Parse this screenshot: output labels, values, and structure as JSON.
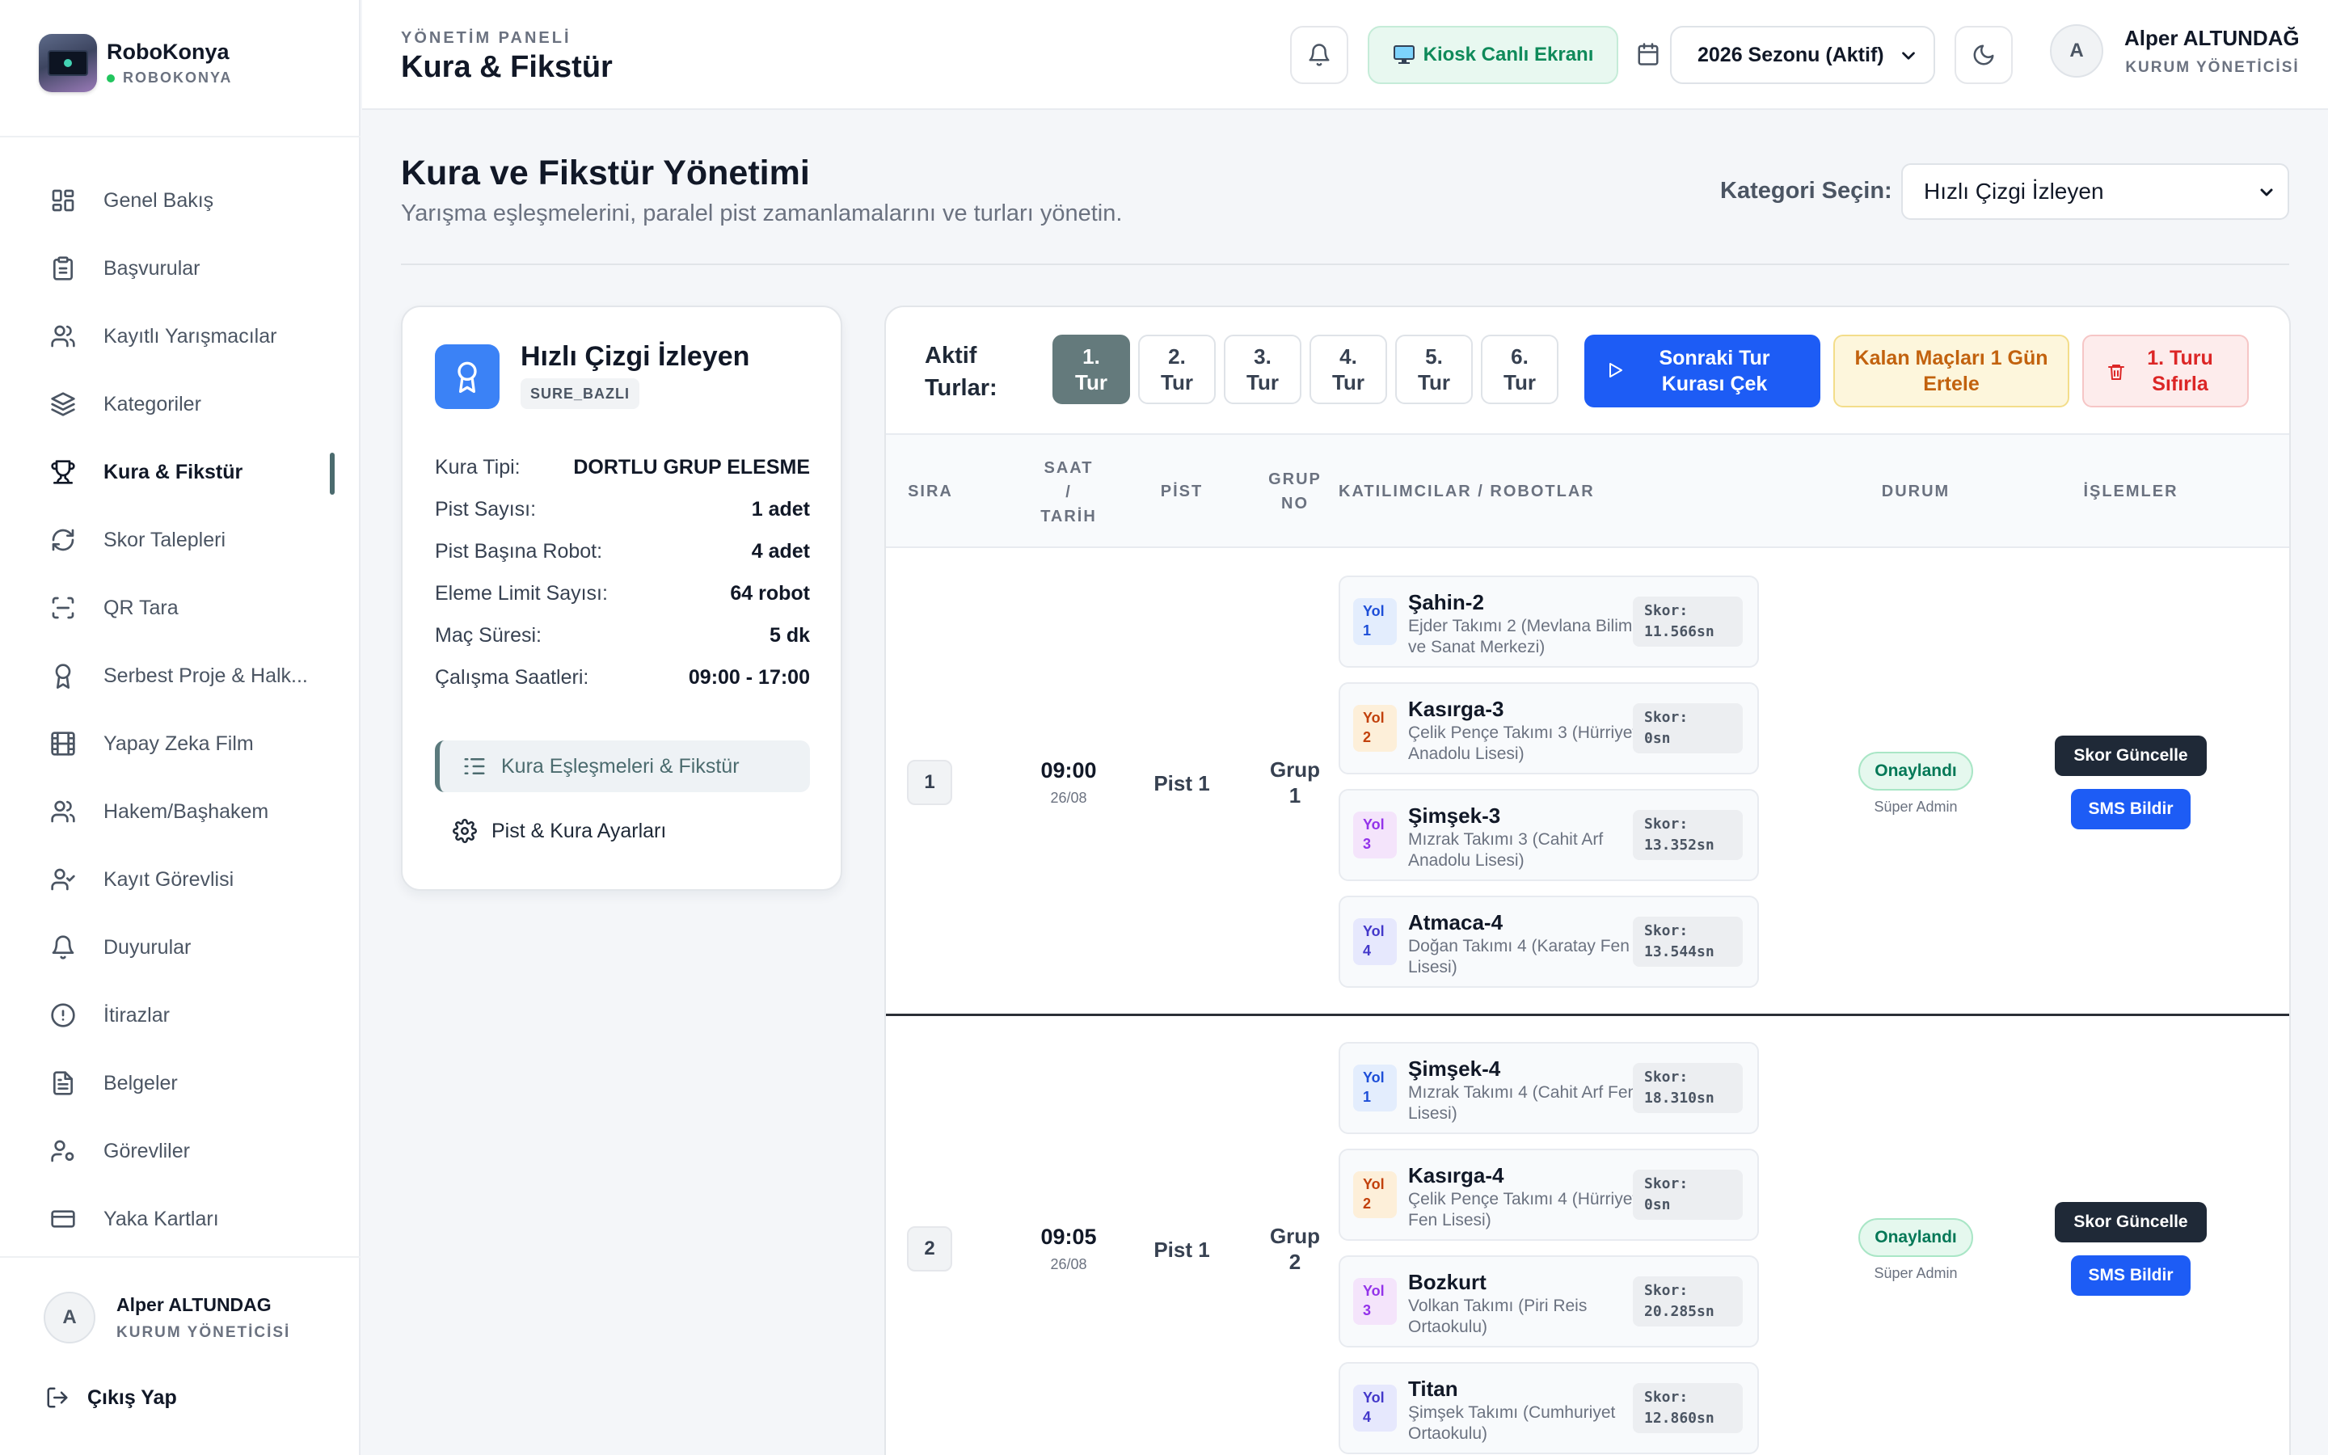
{
  "brand": {
    "name": "RoboKonya",
    "sub": "ROBOKONYA"
  },
  "nav": [
    {
      "label": "Genel Bakış",
      "icon": "grid-icon"
    },
    {
      "label": "Başvurular",
      "icon": "clipboard-icon"
    },
    {
      "label": "Kayıtlı Yarışmacılar",
      "icon": "users-icon"
    },
    {
      "label": "Kategoriler",
      "icon": "layers-icon"
    },
    {
      "label": "Kura & Fikstür",
      "icon": "trophy-icon",
      "active": true
    },
    {
      "label": "Skor Talepleri",
      "icon": "refresh-icon"
    },
    {
      "label": "QR Tara",
      "icon": "scan-icon"
    },
    {
      "label": "Serbest Proje & Halk...",
      "icon": "award-icon"
    },
    {
      "label": "Yapay Zeka Film",
      "icon": "film-icon"
    },
    {
      "label": "Hakem/Başhakem",
      "icon": "users-icon"
    },
    {
      "label": "Kayıt Görevlisi",
      "icon": "user-check-icon"
    },
    {
      "label": "Duyurular",
      "icon": "bell-icon"
    },
    {
      "label": "İtirazlar",
      "icon": "alert-circle-icon"
    },
    {
      "label": "Belgeler",
      "icon": "document-icon"
    },
    {
      "label": "Görevliler",
      "icon": "user-cog-icon"
    },
    {
      "label": "Yaka Kartları",
      "icon": "card-icon"
    }
  ],
  "sidebar_user": {
    "initial": "A",
    "name": "Alper ALTUNDAG",
    "role": "KURUM YÖNETİCİSİ",
    "logout": "Çıkış Yap"
  },
  "header": {
    "crumb": "YÖNETİM PANELİ",
    "title": "Kura & Fikstür",
    "kiosk": "Kiosk Canlı Ekranı",
    "season": "2026 Sezonu (Aktif)",
    "user_initial": "A",
    "user_name": "Alper ALTUNDAĞ",
    "user_role": "KURUM YÖNETİCİSİ"
  },
  "page": {
    "title": "Kura ve Fikstür Yönetimi",
    "subtitle": "Yarışma eşleşmelerini, paralel pist zamanlamalarını ve turları yönetin.",
    "category_label": "Kategori Seçin:",
    "category_value": "Hızlı Çizgi İzleyen"
  },
  "category_card": {
    "title": "Hızlı Çizgi İzleyen",
    "tag": "SURE_BAZLI",
    "props": [
      {
        "k": "Kura Tipi:",
        "v": "DORTLU GRUP ELESME"
      },
      {
        "k": "Pist Sayısı:",
        "v": "1 adet"
      },
      {
        "k": "Pist Başına Robot:",
        "v": "4 adet"
      },
      {
        "k": "Eleme Limit Sayısı:",
        "v": "64 robot"
      },
      {
        "k": "Maç Süresi:",
        "v": "5 dk"
      },
      {
        "k": "Çalışma Saatleri:",
        "v": "09:00 - 17:00"
      }
    ],
    "menu1": "Kura Eşleşmeleri & Fikstür",
    "menu2": "Pist & Kura Ayarları"
  },
  "toolbar": {
    "label_line1": "Aktif",
    "label_line2": "Turlar:",
    "rounds": [
      {
        "n": "1.",
        "t": "Tur",
        "active": true
      },
      {
        "n": "2.",
        "t": "Tur"
      },
      {
        "n": "3.",
        "t": "Tur"
      },
      {
        "n": "4.",
        "t": "Tur"
      },
      {
        "n": "5.",
        "t": "Tur"
      },
      {
        "n": "6.",
        "t": "Tur"
      }
    ],
    "next_l1": "Sonraki Tur",
    "next_l2": "Kurası Çek",
    "postpone_l1": "Kalan Maçları 1 Gün",
    "postpone_l2": "Ertele",
    "reset_l1": "1. Turu",
    "reset_l2": "Sıfırla"
  },
  "table": {
    "headers": {
      "sira": "SIRA",
      "saat1": "SAAT",
      "saat2": "/",
      "saat3": "TARİH",
      "pist": "PİST",
      "grup1": "GRUP",
      "grup2": "NO",
      "katilim": "KATILIMCILAR / ROBOTLAR",
      "durum": "DURUM",
      "islem": "İŞLEMLER"
    },
    "matches": [
      {
        "sira": "1",
        "time": "09:00",
        "date": "26/08",
        "pist": "Pist 1",
        "grup1": "Grup",
        "grup2": "1",
        "status": "Onaylandı",
        "by": "Süper Admin",
        "skor_btn": "Skor Güncelle",
        "sms_btn": "SMS Bildir",
        "robots": [
          {
            "yol1": "Yol",
            "yol2": "1",
            "name": "Şahin-2",
            "team": "Ejder Takımı 2 (Mevlana Bilim ve Sanat Merkezi)",
            "s1": "Skor:",
            "s2": "11.566sn"
          },
          {
            "yol1": "Yol",
            "yol2": "2",
            "name": "Kasırga-3",
            "team": "Çelik Pençe Takımı 3 (Hürriyet Anadolu Lisesi)",
            "s1": "Skor:",
            "s2": "0sn"
          },
          {
            "yol1": "Yol",
            "yol2": "3",
            "name": "Şimşek-3",
            "team": "Mızrak Takımı 3 (Cahit Arf Anadolu Lisesi)",
            "s1": "Skor:",
            "s2": "13.352sn"
          },
          {
            "yol1": "Yol",
            "yol2": "4",
            "name": "Atmaca-4",
            "team": "Doğan Takımı 4 (Karatay Fen Lisesi)",
            "s1": "Skor:",
            "s2": "13.544sn"
          }
        ]
      },
      {
        "sira": "2",
        "time": "09:05",
        "date": "26/08",
        "pist": "Pist 1",
        "grup1": "Grup",
        "grup2": "2",
        "status": "Onaylandı",
        "by": "Süper Admin",
        "skor_btn": "Skor Güncelle",
        "sms_btn": "SMS Bildir",
        "robots": [
          {
            "yol1": "Yol",
            "yol2": "1",
            "name": "Şimşek-4",
            "team": "Mızrak Takımı 4 (Cahit Arf Fen Lisesi)",
            "s1": "Skor:",
            "s2": "18.310sn"
          },
          {
            "yol1": "Yol",
            "yol2": "2",
            "name": "Kasırga-4",
            "team": "Çelik Pençe Takımı 4 (Hürriyet Fen Lisesi)",
            "s1": "Skor:",
            "s2": "0sn"
          },
          {
            "yol1": "Yol",
            "yol2": "3",
            "name": "Bozkurt",
            "team": "Volkan Takımı (Piri Reis Ortaokulu)",
            "s1": "Skor:",
            "s2": "20.285sn"
          },
          {
            "yol1": "Yol",
            "yol2": "4",
            "name": "Titan",
            "team": "Şimşek Takımı (Cumhuriyet Ortaokulu)",
            "s1": "Skor:",
            "s2": "12.860sn"
          }
        ]
      }
    ]
  }
}
